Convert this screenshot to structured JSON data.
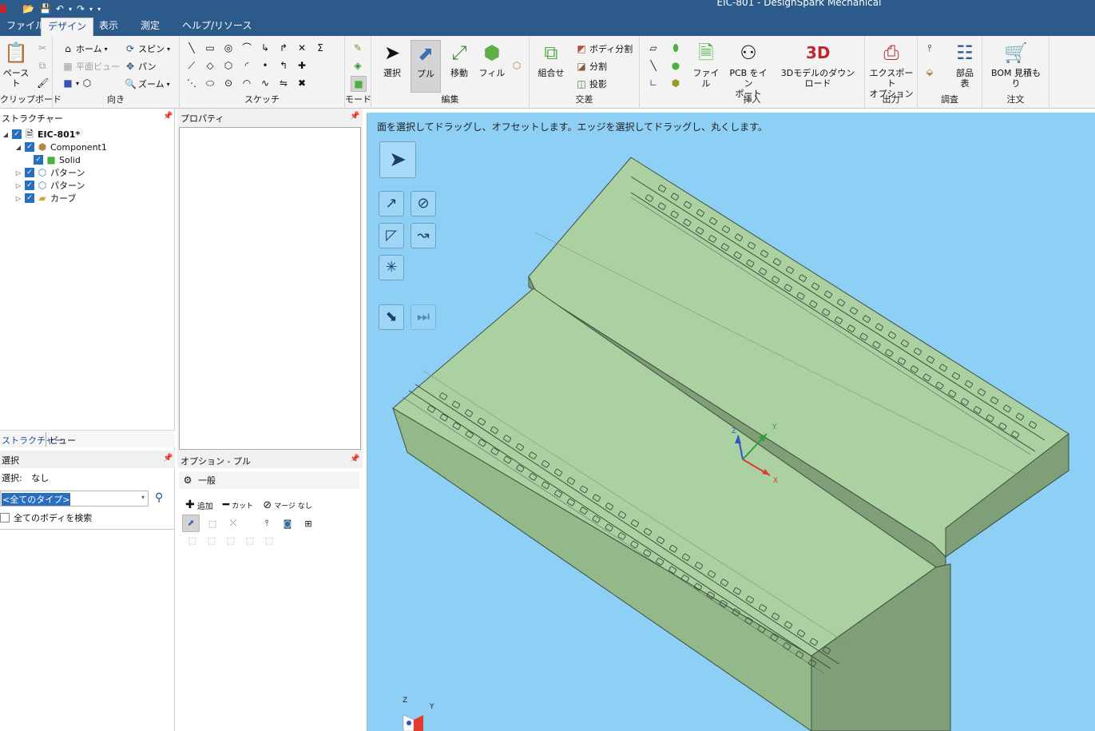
{
  "window": {
    "title": "EIC-801 - DesignSpark Mechanical"
  },
  "tabs": [
    {
      "label": "ファイル"
    },
    {
      "label": "デザイン"
    },
    {
      "label": "表示"
    },
    {
      "label": "測定"
    },
    {
      "label": "ヘルプ/リソース"
    }
  ],
  "ribbon": {
    "clipboard": {
      "label": "クリップボード",
      "paste": "ペースト"
    },
    "orient": {
      "label": "向き",
      "home": "ホーム",
      "plan_view": "平面ビュー",
      "spin": "スピン",
      "pan": "パン",
      "zoom": "ズーム"
    },
    "sketch": {
      "label": "スケッチ"
    },
    "mode": {
      "label": "モード"
    },
    "edit": {
      "label": "編集",
      "select": "選択",
      "pull": "プル",
      "move": "移動",
      "fill": "フィル"
    },
    "intersect": {
      "label": "交差",
      "combine": "組合せ",
      "split_body": "ボディ分割",
      "split": "分割",
      "project": "投影"
    },
    "insert": {
      "label": "挿入",
      "file": "ファイル",
      "pcb_line1": "PCB をイン",
      "pcb_line2": "ポート",
      "download_3d": "3Dモデルのダウンロード",
      "logo_3d": "3D"
    },
    "output": {
      "label": "出力",
      "export_line1": "エクスポート",
      "export_line2": "オプション"
    },
    "investigate": {
      "label": "調査",
      "parts_line1": "部品",
      "parts_line2": "表"
    },
    "order": {
      "label": "注文",
      "bom_line1": "BOM 見積も",
      "bom_line2": "り"
    }
  },
  "structure": {
    "title": "ストラクチャー",
    "items": [
      {
        "label": "EIC-801*"
      },
      {
        "label": "Component1"
      },
      {
        "label": "Solid"
      },
      {
        "label": "パターン"
      },
      {
        "label": "パターン"
      },
      {
        "label": "カーブ"
      }
    ],
    "bottom_tabs": [
      {
        "label": "ストラクチャー"
      },
      {
        "label": "ビュー"
      }
    ]
  },
  "selection": {
    "title": "選択",
    "status_label": "選択:",
    "status_value": "なし",
    "type_value": "<全てのタイプ>",
    "search_all_label": "全てのボディを検索"
  },
  "properties": {
    "title": "プロパティ"
  },
  "options": {
    "title": "オプション - プル",
    "general": "一般",
    "add": "追加",
    "cut": "カット",
    "no_merge": "マージ なし"
  },
  "viewport": {
    "hint": "面を選択してドラッグし、オフセットします。エッジを選択してドラッグし、丸くします。",
    "triad": {
      "x": "X",
      "y": "Y",
      "z": "Z"
    },
    "mini_triad": {
      "z": "Z",
      "y": "Y"
    }
  },
  "colors": {
    "titlebar": "#2b5a8b",
    "viewport_bg": "#8ecff5",
    "model_top": "#abd1a3",
    "model_side": "#7f9f78",
    "model_front": "#93b98a"
  }
}
